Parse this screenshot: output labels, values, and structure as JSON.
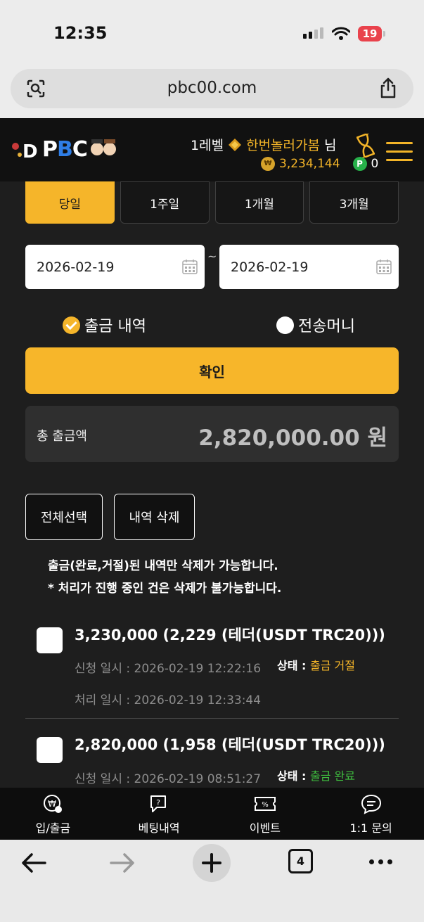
{
  "status_bar": {
    "time": "12:35",
    "battery": "19"
  },
  "browser": {
    "url": "pbc00.com",
    "tab_count": "4"
  },
  "header": {
    "logo": "PBC",
    "level": "1레벨",
    "username": "한번놀러가봄",
    "honorific": "님",
    "coin_symbol": "₩",
    "balance": "3,234,144",
    "point_symbol": "P",
    "points": "0"
  },
  "period_tabs": [
    {
      "label": "당일",
      "active": true
    },
    {
      "label": "1주일",
      "active": false
    },
    {
      "label": "1개월",
      "active": false
    },
    {
      "label": "3개월",
      "active": false
    }
  ],
  "date_range": {
    "start": "2026-02-19",
    "separator": "~",
    "end": "2026-02-19"
  },
  "filter": {
    "withdraw_label": "출금 내역",
    "withdraw_selected": true,
    "transfer_label": "전송머니",
    "transfer_selected": false
  },
  "confirm_label": "확인",
  "total": {
    "label": "총 출금액",
    "value": "2,820,000.00 원"
  },
  "actions": {
    "select_all": "전체선택",
    "delete": "내역 삭제"
  },
  "notices": [
    "출금(완료,거절)된 내역만 삭제가 가능합니다.",
    "* 처리가 진행 중인 건은 삭제가 불가능합니다."
  ],
  "transactions": [
    {
      "title": "3,230,000 (2,229 (테더(USDT TRC20)))",
      "requested_label": "신청 일시 :",
      "requested": "2026-02-19 12:22:16",
      "status_label": "상태 :",
      "status": "출금 거절",
      "processed_label": "처리 일시 :",
      "processed": "2026-02-19 12:33:44"
    },
    {
      "title": "2,820,000 (1,958 (테더(USDT TRC20)))",
      "requested_label": "신청 일시 :",
      "requested": "2026-02-19 08:51:27",
      "status_label": "상태 :",
      "status": "출금 완료"
    }
  ],
  "bottom_nav": [
    {
      "label": "입/출금",
      "icon": "deposit-withdraw-icon"
    },
    {
      "label": "베팅내역",
      "icon": "betting-history-icon"
    },
    {
      "label": "이벤트",
      "icon": "event-ticket-icon"
    },
    {
      "label": "1:1 문의",
      "icon": "chat-inquiry-icon"
    }
  ],
  "colors": {
    "accent": "#f5b52a",
    "reject": "#f3b428",
    "complete": "#3fbf3f",
    "background": "#1e1e1e"
  }
}
